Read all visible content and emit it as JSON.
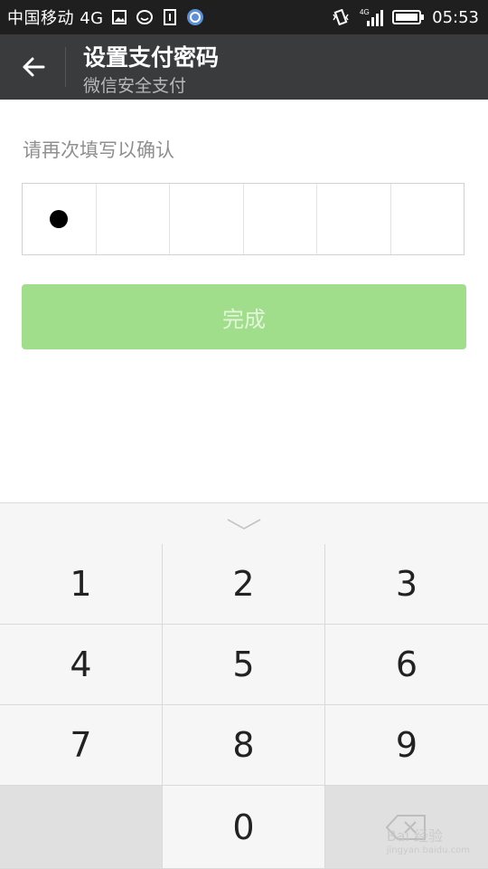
{
  "status_bar": {
    "carrier": "中国移动 4G",
    "network_badge": "4G",
    "time": "05:53"
  },
  "app_bar": {
    "title": "设置支付密码",
    "subtitle": "微信安全支付"
  },
  "form": {
    "prompt": "请再次填写以确认",
    "entered_digits": 1,
    "total_digits": 6,
    "done_label": "完成"
  },
  "keyboard": {
    "keys": [
      "1",
      "2",
      "3",
      "4",
      "5",
      "6",
      "7",
      "8",
      "9",
      "",
      "0",
      "⌫"
    ]
  },
  "watermark": {
    "text": "Bai 经验",
    "url_text": "jingyan.baidu.com"
  },
  "colors": {
    "appbar": "#3a3b3d",
    "done_button": "#a0de8c"
  }
}
